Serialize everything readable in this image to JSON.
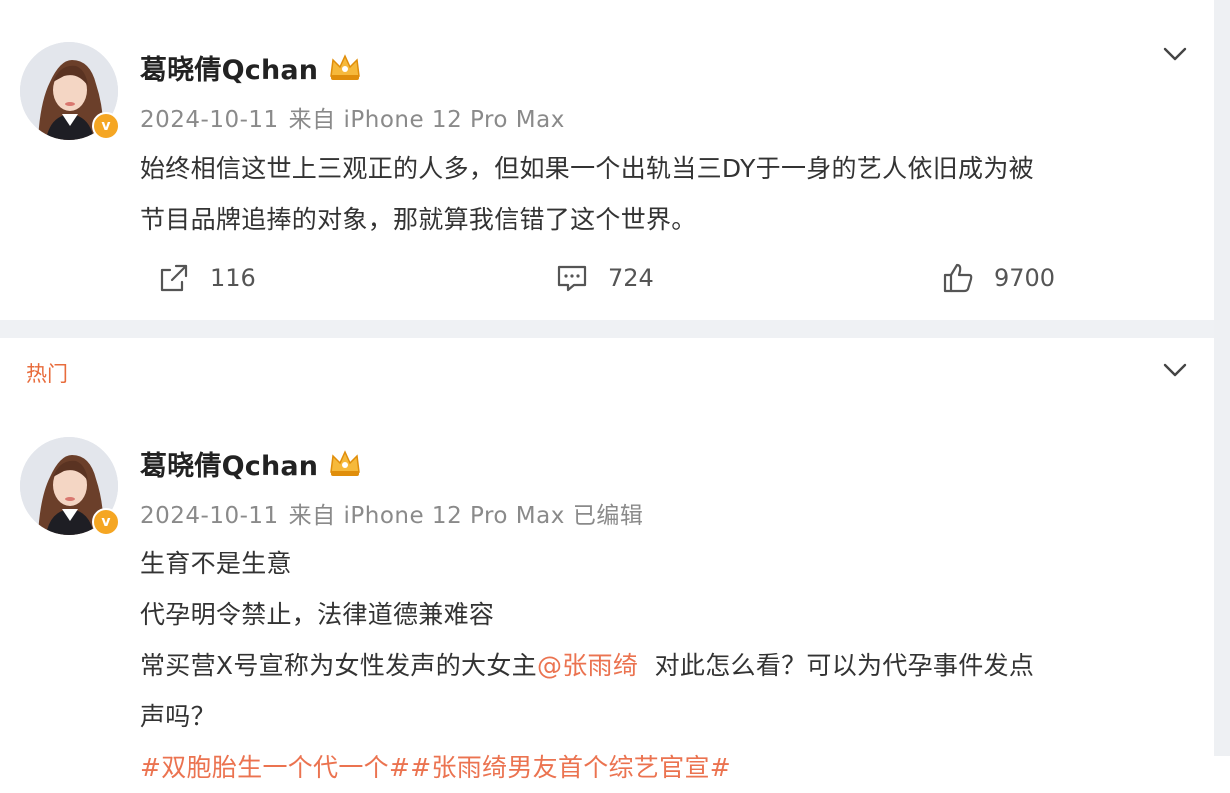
{
  "colors": {
    "accent": "#eb7350",
    "verified": "#f5a623",
    "meta_gray": "#8a8a8a",
    "divider": "#eff1f4"
  },
  "post1": {
    "username": "葛晓倩Qchan",
    "date": "2024-10-11",
    "source": "来自 iPhone 12 Pro Max",
    "lines": [
      "始终相信这世上三观正的人多，但如果一个出轨当三DY于一身的艺人依旧成为被",
      "节目品牌追捧的对象，那就算我信错了这个世界。"
    ],
    "repost_count": "116",
    "comment_count": "724",
    "like_count": "9700",
    "icons": {
      "repost": "share-icon",
      "comment": "comment-icon",
      "like": "thumbs-up-icon",
      "more": "chevron-down-icon",
      "badge": "crown-icon",
      "verified": "verified-icon"
    }
  },
  "section": {
    "hot_label": "热门"
  },
  "post2": {
    "username": "葛晓倩Qchan",
    "date": "2024-10-11",
    "source": "来自 iPhone 12 Pro Max",
    "edited": "已编辑",
    "line1": "生育不是生意",
    "line2": "代孕明令禁止，法律道德兼难容",
    "line3_prefix": "常买营X号宣称为女性发声的大女主",
    "mention": "@张雨绮",
    "line3_suffix": "  对此怎么看？可以为代孕事件发点",
    "line4": "声吗？",
    "tags": "#双胞胎生一个代一个##张雨绮男友首个综艺官宣#"
  }
}
